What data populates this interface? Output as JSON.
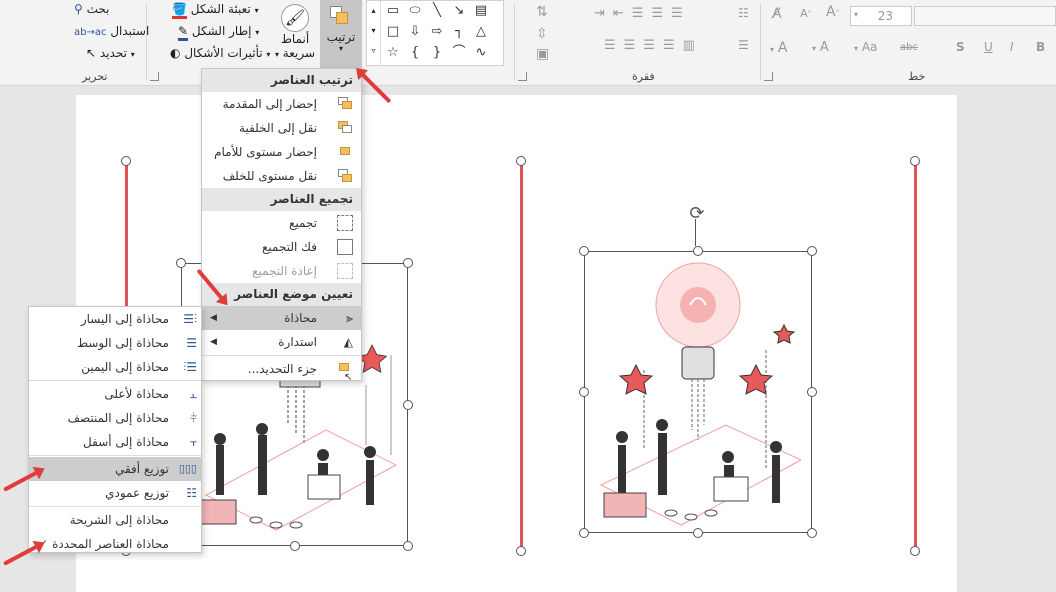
{
  "editing_group": {
    "label": "تحرير",
    "find": "بحث",
    "replace": "استبدال",
    "select": "تحديد"
  },
  "drawing_group": {
    "shape_fill": "تعبئة الشكل",
    "shape_outline": "إطار الشكل",
    "shape_effects": "تأثيرات الأشكال",
    "quick_styles_line1": "أنماط",
    "quick_styles_line2": "سريعة",
    "arrange": "ترتيب"
  },
  "paragraph_group": {
    "label": "فقرة"
  },
  "font_group": {
    "label": "خط",
    "font_size": "23",
    "font_size_down": "A",
    "font_size_up": "A",
    "change_case": "Aa",
    "char_spacing": "abc",
    "shadow": "S",
    "underline": "U",
    "italic": "I",
    "bold": "B"
  },
  "arrange_menu": {
    "order_header": "ترتيب العناصر",
    "order_items": [
      {
        "label": "إحضار إلى المقدمة",
        "enabled": true
      },
      {
        "label": "نقل إلى الخلفية",
        "enabled": true
      },
      {
        "label": "إحضار مستوى للأمام",
        "enabled": true
      },
      {
        "label": "نقل مستوى للخلف",
        "enabled": true
      }
    ],
    "group_header": "تجميع العناصر",
    "group_items": [
      {
        "label": "تجميع",
        "enabled": true
      },
      {
        "label": "فك التجميع",
        "enabled": true
      },
      {
        "label": "إعادة التجميع",
        "enabled": false
      }
    ],
    "position_header": "تعيين موضع العناصر",
    "position_items": [
      {
        "label": "محاذاة",
        "highlighted": true
      },
      {
        "label": "استدارة",
        "highlighted": false
      },
      {
        "label": "جزء التحديد...",
        "highlighted": false
      }
    ]
  },
  "align_submenu": {
    "items": [
      {
        "label": "محاذاة إلى اليسار"
      },
      {
        "label": "محاذاة إلى الوسط"
      },
      {
        "label": "محاذاة إلى اليمين"
      },
      {
        "label": "محاذاة لأعلى"
      },
      {
        "label": "محاذاة إلى المنتصف"
      },
      {
        "label": "محاذاة إلى أسفل"
      },
      {
        "label": "توزيع أفقي"
      },
      {
        "label": "توزيع عمودي"
      },
      {
        "label": "محاذاة إلى الشريحة"
      },
      {
        "label": "محاذاة العناصر المحددة"
      }
    ],
    "checked_mark": "✓"
  },
  "colors": {
    "accent_red": "#e03c3c",
    "line_red": "#d55555",
    "icon_gold": "#f2c063",
    "highlight": "#cdcdcd"
  }
}
